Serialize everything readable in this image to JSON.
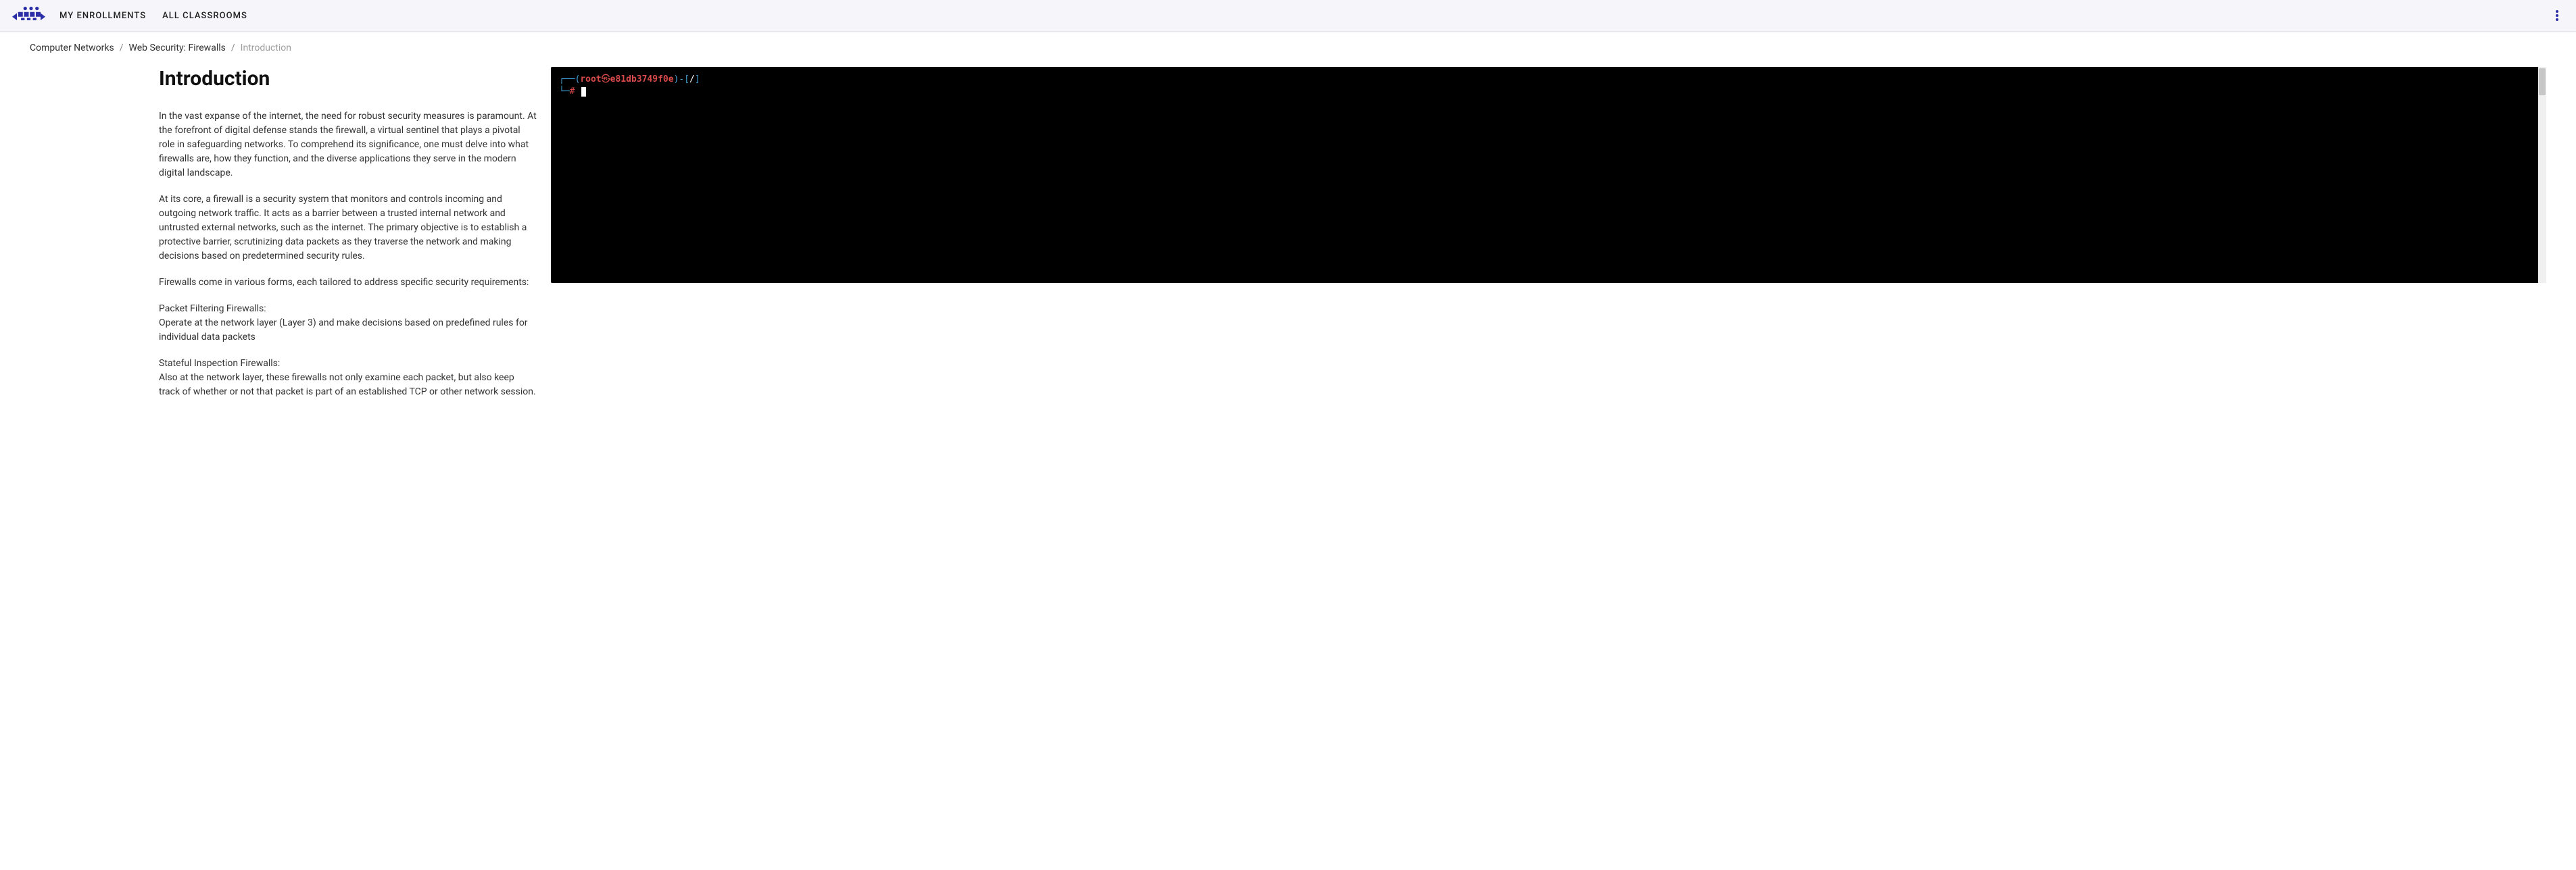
{
  "nav": {
    "links": [
      "MY ENROLLMENTS",
      "ALL CLASSROOMS"
    ]
  },
  "breadcrumb": {
    "items": [
      "Computer Networks",
      "Web Security: Firewalls"
    ],
    "current": "Introduction"
  },
  "lesson": {
    "title": "Introduction",
    "paragraphs": [
      "In the vast expanse of the internet, the need for robust security measures is paramount. At the forefront of digital defense stands the firewall, a virtual sentinel that plays a pivotal role in safeguarding networks. To comprehend its significance, one must delve into what firewalls are, how they function, and the diverse applications they serve in the modern digital landscape.",
      "At its core, a firewall is a security system that monitors and controls incoming and outgoing network traffic. It acts as a barrier between a trusted internal network and untrusted external networks, such as the internet. The primary objective is to establish a protective barrier, scrutinizing data packets as they traverse the network and making decisions based on predetermined security rules.",
      "Firewalls come in various forms, each tailored to address specific security requirements:"
    ],
    "types": [
      {
        "name": "Packet Filtering Firewalls:",
        "desc": "Operate at the network layer (Layer 3) and make decisions based on predefined rules for individual data packets"
      },
      {
        "name": "Stateful Inspection Firewalls:",
        "desc": "Also at the network layer, these firewalls not only examine each packet, but also keep track of whether or not that packet is part of an established TCP or other network session."
      }
    ]
  },
  "terminal": {
    "user": "root",
    "host": "e81db3749f0e",
    "path": "/",
    "prompt_hash": "#"
  }
}
